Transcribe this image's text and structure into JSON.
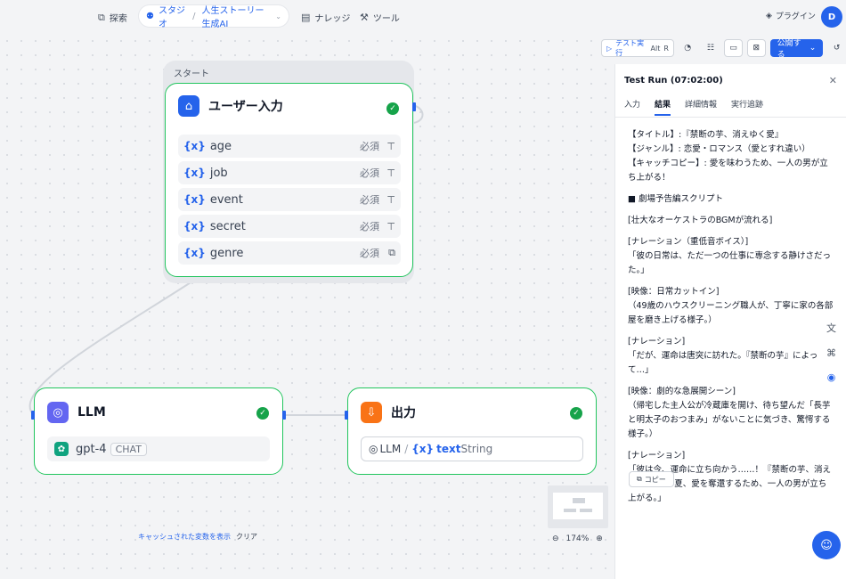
{
  "nav": {
    "explore": "探索",
    "studio": "スタジオ",
    "app_name": "人生ストーリー生成AI",
    "knowledge": "ナレッジ",
    "tools": "ツール",
    "plugin": "プラグイン",
    "avatar": "D"
  },
  "toolbar": {
    "test_run": "テスト実行",
    "shortcut_alt": "Alt",
    "shortcut_r": "R",
    "publish": "公開する"
  },
  "start_group": {
    "label": "スタート"
  },
  "user_input_node": {
    "title": "ユーザー入力",
    "variables": [
      {
        "name": "age",
        "required": "必須"
      },
      {
        "name": "job",
        "required": "必須"
      },
      {
        "name": "event",
        "required": "必須"
      },
      {
        "name": "secret",
        "required": "必須"
      },
      {
        "name": "genre",
        "required": "必須"
      }
    ]
  },
  "llm_node": {
    "title": "LLM",
    "model": "gpt-4",
    "mode": "CHAT"
  },
  "output_node": {
    "title": "出力",
    "source_node": "LLM",
    "source_var": "text",
    "source_type": "String"
  },
  "canvas": {
    "show_cached": "キャッシュされた変数を表示",
    "clear": "クリア",
    "zoom": "174%"
  },
  "panel": {
    "title": "Test Run (07:02:00)",
    "tabs": [
      "入力",
      "結果",
      "詳細情報",
      "実行追跡"
    ],
    "active_tab": "結果",
    "result_paragraphs": [
      "【タイトル】:『禁断の芋、消えゆく愛』\n【ジャンル】: 恋愛・ロマンス（愛とすれ違い）\n【キャッチコピー】: 愛を味わうため、一人の男が立ち上がる！",
      "■ 劇場予告編スクリプト",
      "[壮大なオーケストラのBGMが流れる]",
      "[ナレーション（重低音ボイス）]\n「彼の日常は、ただ一つの仕事に専念する静けさだった。」",
      "[映像：日常カットイン]\n（49歳のハウスクリーニング職人が、丁寧に家の各部屋を磨き上げる様子。）",
      "[ナレーション]\n「だが、運命は唐突に訪れた。『禁断の芋』によって…」",
      "[映像：劇的な急展開シーン]\n（帰宅した主人公が冷蔵庫を開け、待ち望んだ「長芋と明太子のおつまみ」がないことに気づき、驚愕する様子。）",
      "[ナレーション]\n「彼は今、運命に立ち向かう……！『禁断の芋、消えゆく愛』。今夏、愛を奪還するため、一人の男が立ち上がる。」"
    ],
    "copy": "コピー"
  }
}
